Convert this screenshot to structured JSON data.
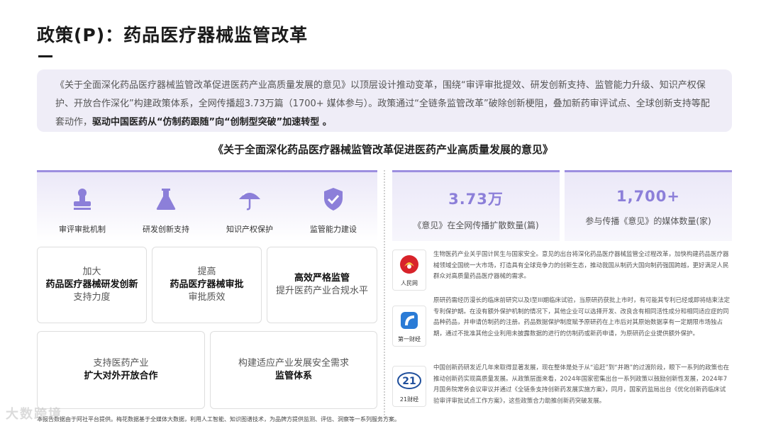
{
  "header": {
    "title": "政策(P)：药品医疗器械监管改革"
  },
  "summary": {
    "text": "《关于全面深化药品医疗器械监管改革促进医药产业高质量发展的意见》以顶层设计推动变革，围绕“审评审批提效、研发创新支持、监管能力升级、知识产权保护、开放合作深化”构建政策体系，全网传播超3.73万篇（1700+ 媒体参与）。政策通过“全链条监管改革”破除创新梗阻，叠加新药审评试点、全球创新支持等配套动作，",
    "highlight": "驱动中国医药从“仿制药跟随”向“创制型突破”加速转型",
    "end": " 。"
  },
  "document": {
    "title": "《关于全面深化药品医疗器械监管改革促进医药产业高质量发展的意见》"
  },
  "features": [
    {
      "label": "审评审批机制",
      "icon": "stamp-icon"
    },
    {
      "label": "研发创新支持",
      "icon": "flask-icon"
    },
    {
      "label": "知识产权保护",
      "icon": "umbrella-icon"
    },
    {
      "label": "监管能力建设",
      "icon": "shield-check-icon"
    }
  ],
  "cards": [
    {
      "t1": "加大",
      "t2": "药品医疗器械研发创新",
      "t3": "支持力度"
    },
    {
      "t1": "提高",
      "t2": "药品医疗器械审批",
      "t3": "审批质效"
    },
    {
      "t1": "",
      "t2": "高效严格监管",
      "t3": "提升医药产业合规水平"
    },
    {
      "t1": "支持医药产业",
      "t2": "扩大对外开放合作",
      "t3": ""
    },
    {
      "t1": "构建适应产业发展安全需求",
      "t2": "监管体系",
      "t3": ""
    }
  ],
  "stats": [
    {
      "value": "3.73万",
      "caption": "《意见》在全网传播扩散数量(篇)"
    },
    {
      "value": "1,700+",
      "caption": "参与传播《意见》的媒体数量(家)"
    }
  ],
  "news": [
    {
      "source": "人民网",
      "icon": "people-daily-logo",
      "text": "生物医药产业关乎国计民生与国家安全。意见的出台将深化药品医疗器械监管全过程改革，加快构建药品医疗器械领域全国统一大市场，打造具有全球竞争力的创新生态，推动我国从制药大国向制药强国跨越，更好满足人民群众对高质量药品医疗器械的需求。"
    },
    {
      "source": "第一财经",
      "icon": "yicai-logo",
      "text": "原研药需经历漫长的临床前研究以及I至III期临床试验，当原研药获批上市时，有可能其专利已经或即将结束法定专利保护期。在没有额外保护机制的情况下，其他企业可以选择开发、改良含有相同活性成分和相同适应症的同品种药品，并申请仿制药的注册。药品数据保护制度赋予原研药在上市后对其原始数据享有一定期限市场独占期，通过不批准其他企业利用未披露数据的进行的仿制药或新药申请，为原研药企业提供额外保护。"
    },
    {
      "source": "21财经",
      "icon": "21-finance-logo",
      "text": "中国创新药研发近几年来取得显著发展，现在整体是处于从“追赶”到“并跑”的过渡阶段，眼下一系列的政策也在推动创新药实现高质量发展。从政策层面来看，2024年国家密集出台一系列政策以鼓励创新性发展，2024年7月国务院常务会议审议并通过《全链条支持创新药发展实施方案》，同月，国家药监局出台《优化创新药临床试验审评审批试点工作方案》，这些政策合力助推创新药突破发展。"
    }
  ],
  "footnote": "本报告数据由于阿社平台提供。梅花数据基于全媒体大数据，利用人工智能、知识图谱技术，为品牌方提供监测、评估、洞察等一系列服务方案。",
  "watermark": "大数跨境",
  "colors": {
    "accent": "#8c7fd9",
    "panel": "#efedf7"
  }
}
